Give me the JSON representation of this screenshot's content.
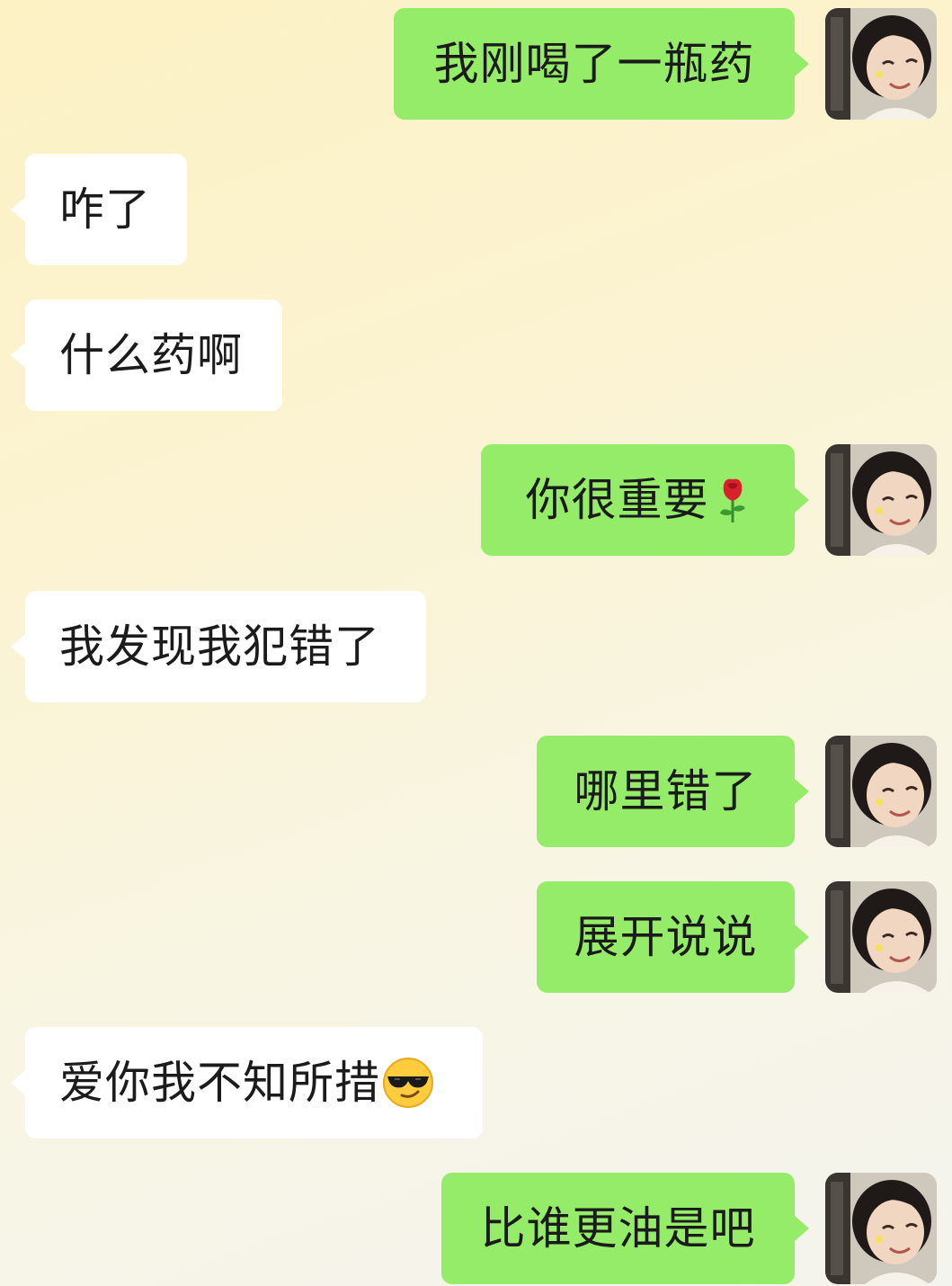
{
  "messages": [
    {
      "side": "out",
      "text": "我刚喝了一瓶药"
    },
    {
      "side": "in",
      "text": "咋了"
    },
    {
      "side": "in",
      "text": "什么药啊"
    },
    {
      "side": "out",
      "text": "你很重要",
      "emoji": "rose-emoji"
    },
    {
      "side": "in",
      "text": "我发现我犯错了"
    },
    {
      "side": "out",
      "text": "哪里错了"
    },
    {
      "side": "out",
      "text": "展开说说"
    },
    {
      "side": "in",
      "text": "爱你我不知所措",
      "emoji": "sunglasses-emoji"
    },
    {
      "side": "out",
      "text": "比谁更油是吧"
    }
  ],
  "colors": {
    "outgoing_bubble": "#95ec69",
    "incoming_bubble": "#ffffff",
    "text": "#1b1b1b"
  },
  "icons": {
    "avatar": "avatar-photo-girl"
  }
}
